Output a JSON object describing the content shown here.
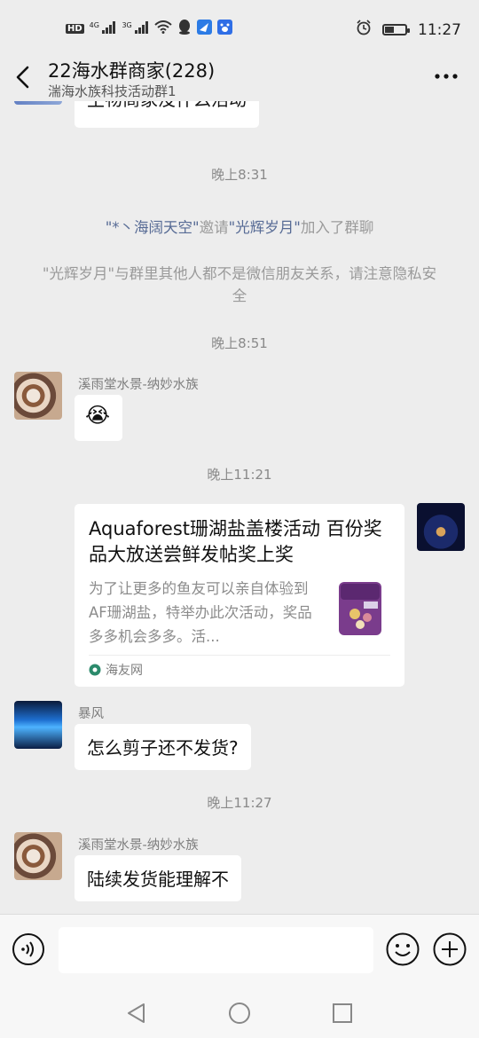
{
  "status_bar": {
    "left_icons": [
      "hd-icon",
      "signal-4g-icon",
      "signal-3g-icon",
      "wifi-icon",
      "qq-icon",
      "feishu-icon",
      "baidu-icon"
    ],
    "hd": "HD",
    "net1": "4G",
    "net2": "3G",
    "time": "11:27"
  },
  "header": {
    "title": "22海水群商家(228)",
    "subtitle": "湍海水族科技活动群1"
  },
  "messages": {
    "partial_bubble": "生物商家没什么活动",
    "time_1": "晚上8:31",
    "sys_invite": {
      "inviter": "\"*丶海阔天空\"",
      "mid": "邀请",
      "invitee": "\"光辉岁月\"",
      "tail": "加入了群聊"
    },
    "sys_privacy": "\"光辉岁月\"与群里其他人都不是微信朋友关系，请注意隐私安全",
    "time_2": "晚上8:51",
    "msg1_sender": "溪雨堂水景-纳妙水族",
    "msg1_emoji": "😭",
    "time_3": "晚上11:21",
    "card": {
      "title": "Aquaforest珊湖盐盖楼活动 百份奖品大放送尝鲜发帖奖上奖",
      "desc": "为了让更多的鱼友可以亲自体验到AF珊湖盐，特举办此次活动，奖品多多机会多多。活...",
      "source": "海友网"
    },
    "msg2_sender": "暴风",
    "msg2_text": "怎么剪子还不发货?",
    "time_4": "晚上11:27",
    "msg3_sender": "溪雨堂水景-纳妙水族",
    "msg3_text": "陆续发货能理解不"
  },
  "colors": {
    "background": "#ededed",
    "link": "#576b95",
    "bubble": "#ffffff"
  }
}
